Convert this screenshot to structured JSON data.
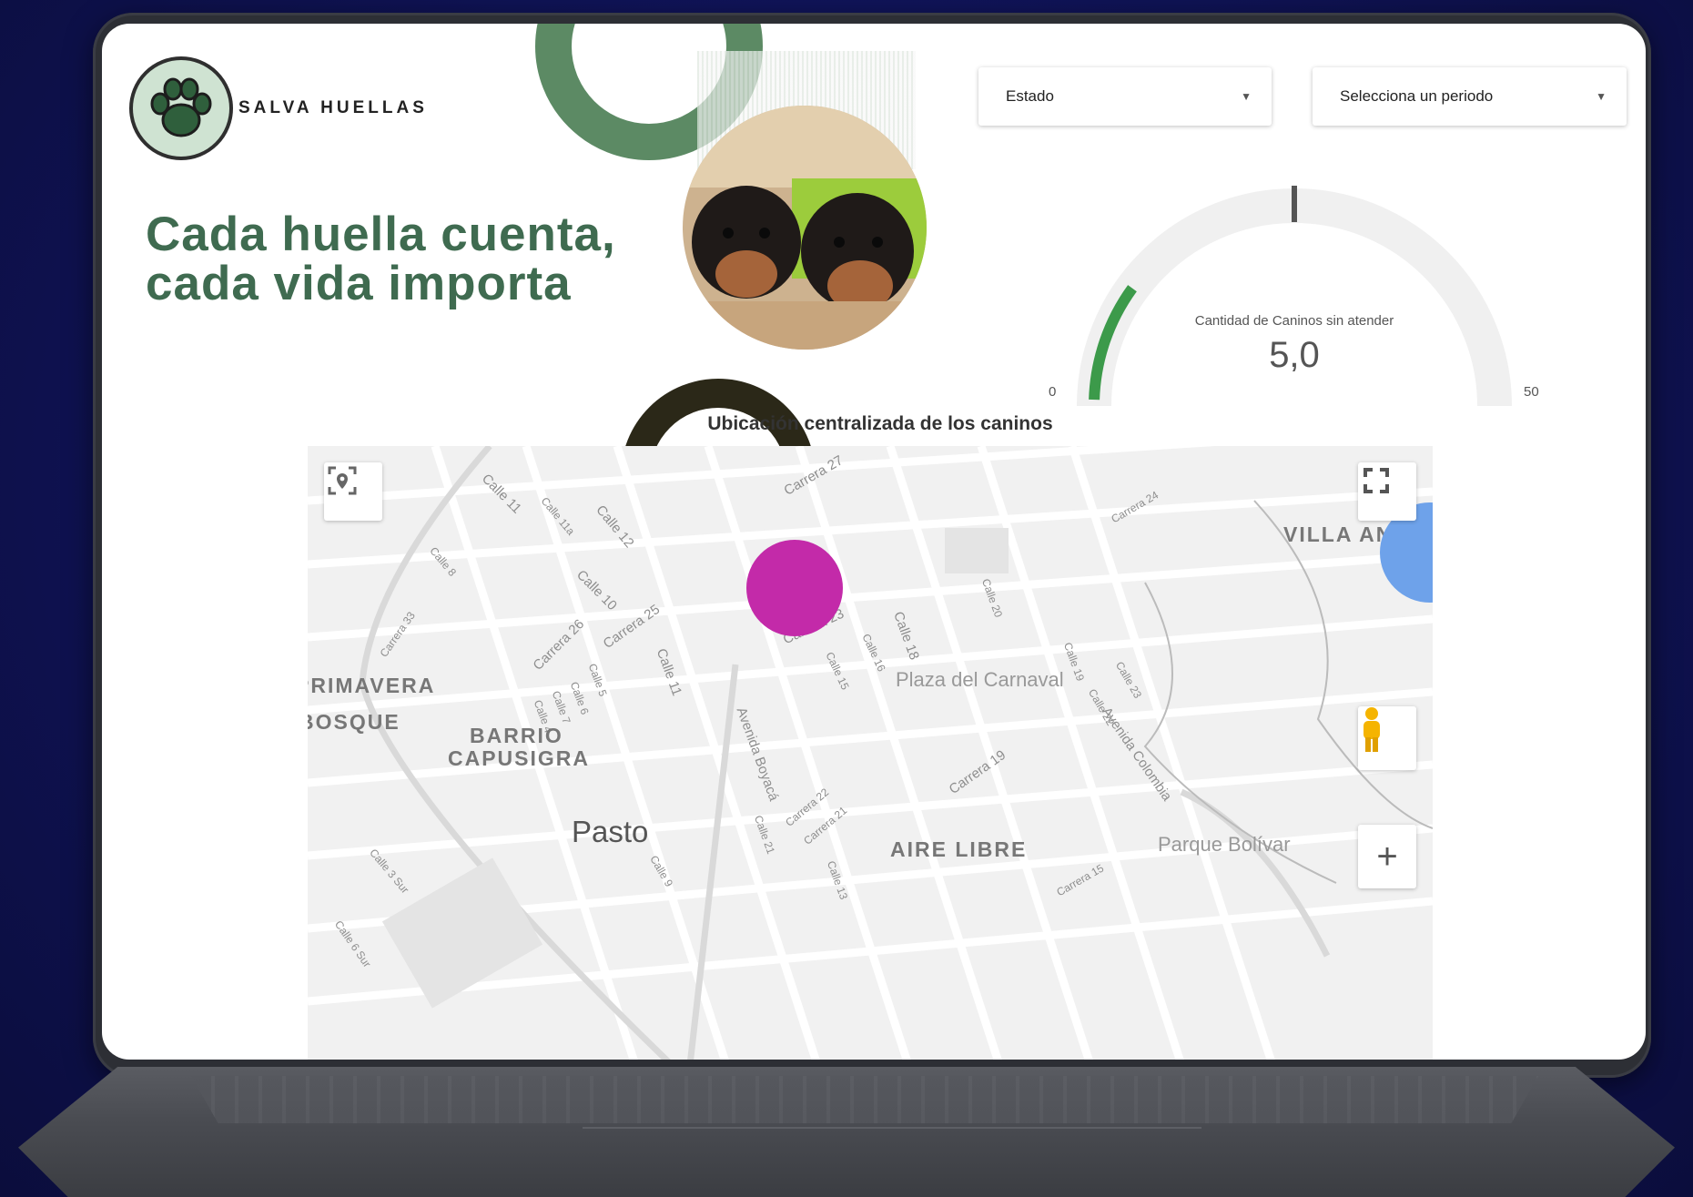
{
  "brand": {
    "name": "SALVA HUELLAS"
  },
  "hero": {
    "line1": "Cada huella cuenta,",
    "line2": "cada vida importa"
  },
  "filters": {
    "estado_label": "Estado",
    "periodo_label": "Selecciona un periodo"
  },
  "gauge": {
    "label": "Cantidad de Caninos sin atender",
    "value": "5,0",
    "min": "0",
    "max": "50",
    "fraction": 0.1,
    "target_fraction": 0.5,
    "fill_color": "#3c9a4a"
  },
  "map": {
    "title": "Ubicación centralizada de los caninos",
    "streets": [
      "Calle 11",
      "Calle 11a",
      "Calle 12",
      "Calle 8",
      "Calle 10",
      "Carrera 27",
      "Carrera 26",
      "Carrera 25",
      "Carrera 23",
      "Carrera 24",
      "Calle 18",
      "Calle 20",
      "Calle 11",
      "Calle 15",
      "Calle 16",
      "Avenida Boyacá",
      "Avenida Colombia",
      "Carrera 19",
      "Calle 13",
      "Carrera 15",
      "Calle 3 Sur",
      "Calle 6 Sur",
      "Calle 9",
      "Calle 7",
      "Calle 21",
      "Carrera 22",
      "Carrera 21",
      "Calle 19",
      "Calle 22",
      "Calle 23",
      "Carrera 33",
      "Calle 6",
      "Calle 5",
      "Calle 4"
    ],
    "areas": {
      "villa_angel": "VILLA ANGEL",
      "primavera": "PRIMAVERA",
      "bosque": "BOSQUE",
      "barrio": "BARRIO",
      "capusigra": "CAPUSIGRA",
      "aire_libre": "AIRE LIBRE"
    },
    "places": {
      "plaza": "Plaza del Carnaval",
      "parque": "Parque Bolívar"
    },
    "city": "Pasto",
    "zoom_in": "+",
    "marker_color": "#c32aa9"
  }
}
